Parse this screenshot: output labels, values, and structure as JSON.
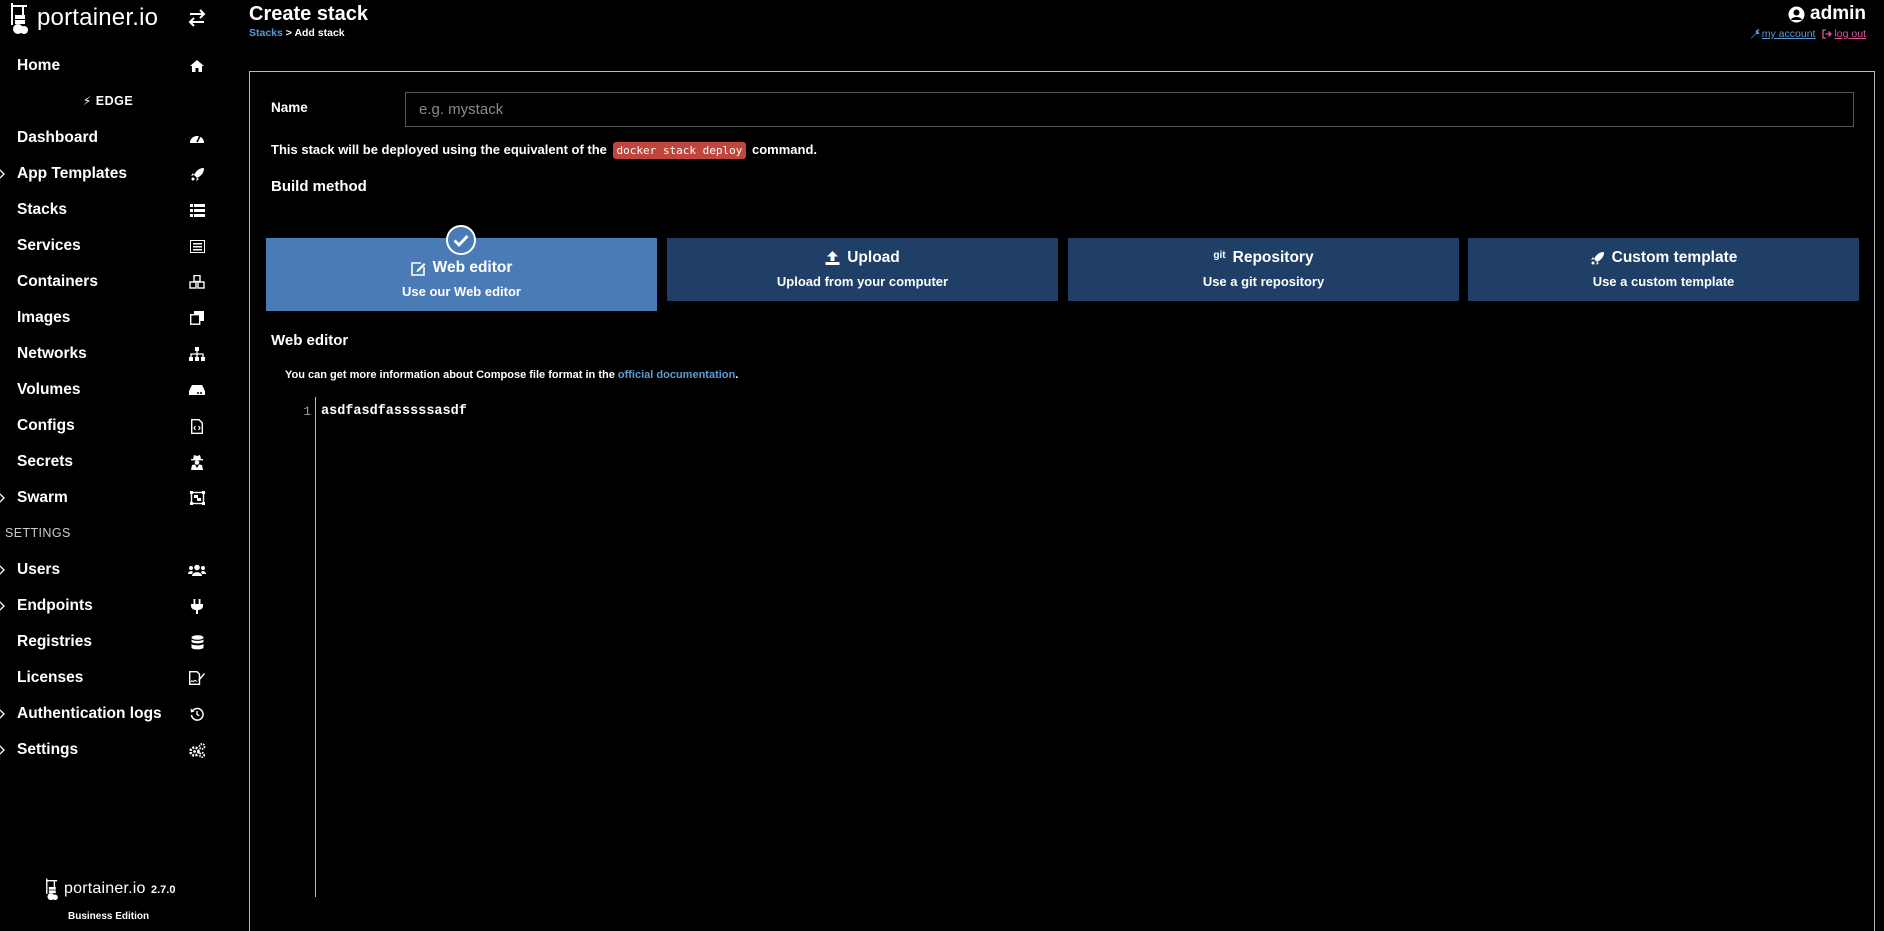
{
  "brand": {
    "logo_text": "portainer.io"
  },
  "sidebar": {
    "home_label": "Home",
    "edge_label": "EDGE",
    "items": [
      {
        "label": "Dashboard",
        "icon": "tachometer-icon"
      },
      {
        "label": "App Templates",
        "icon": "rocket-icon"
      },
      {
        "label": "Stacks",
        "icon": "list-icon"
      },
      {
        "label": "Services",
        "icon": "list-alt-icon"
      },
      {
        "label": "Containers",
        "icon": "cubes-icon"
      },
      {
        "label": "Images",
        "icon": "clone-icon"
      },
      {
        "label": "Networks",
        "icon": "sitemap-icon"
      },
      {
        "label": "Volumes",
        "icon": "hdd-icon"
      },
      {
        "label": "Configs",
        "icon": "file-code-icon"
      },
      {
        "label": "Secrets",
        "icon": "user-secret-icon"
      },
      {
        "label": "Swarm",
        "icon": "object-group-icon"
      }
    ],
    "settings_heading": "SETTINGS",
    "settings_items": [
      {
        "label": "Users",
        "icon": "users-icon"
      },
      {
        "label": "Endpoints",
        "icon": "plug-icon"
      },
      {
        "label": "Registries",
        "icon": "database-icon"
      },
      {
        "label": "Licenses",
        "icon": "file-signature-icon"
      },
      {
        "label": "Authentication logs",
        "icon": "history-icon"
      },
      {
        "label": "Settings",
        "icon": "cogs-icon"
      }
    ],
    "footer": {
      "logo_text": "portainer.io",
      "version": "2.7.0",
      "edition": "Business Edition"
    }
  },
  "header": {
    "title": "Create stack",
    "breadcrumb_link": "Stacks",
    "breadcrumb_current": "> Add stack",
    "username": "admin",
    "my_account": "my account",
    "log_out": "log out"
  },
  "form": {
    "name_label": "Name",
    "name_placeholder": "e.g. mystack",
    "deploy_prefix": "This stack will be deployed using the equivalent of the",
    "deploy_code": "docker stack deploy",
    "deploy_suffix": "command.",
    "build_method_title": "Build method",
    "methods": [
      {
        "title": "Web editor",
        "subtitle": "Use our Web editor",
        "selected": true
      },
      {
        "title": "Upload",
        "subtitle": "Upload from your computer",
        "selected": false
      },
      {
        "title": "Repository",
        "subtitle": "Use a git repository",
        "selected": false,
        "prefix": "git"
      },
      {
        "title": "Custom template",
        "subtitle": "Use a custom template",
        "selected": false
      }
    ],
    "editor_title": "Web editor",
    "info_prefix": "You can get more information about Compose file format in the",
    "info_link": "official documentation",
    "info_suffix": ".",
    "editor_line_number": "1",
    "editor_content": "asdfasdfasssssasdf"
  },
  "colors": {
    "background": "#000000",
    "selected_method": "#4a7bb7",
    "method": "#1f3f66",
    "link": "#5b9bd5",
    "logout": "#e0539b",
    "code_badge": "#c0453d"
  }
}
